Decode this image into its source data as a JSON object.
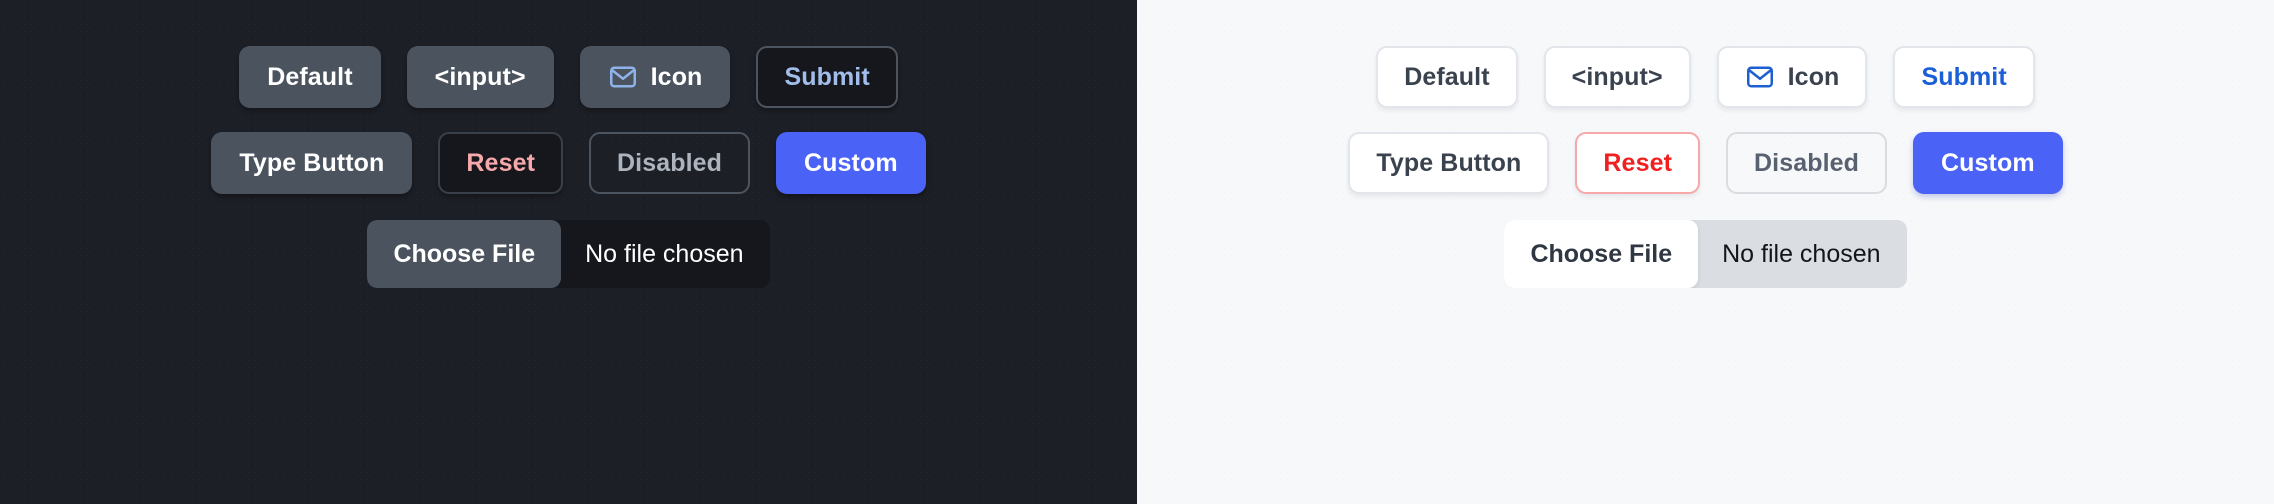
{
  "panels": [
    {
      "theme": "dark",
      "background": "#1c1f26",
      "rows": [
        {
          "buttons": [
            {
              "label": "Default",
              "variant": "solid",
              "icon": null,
              "disabled": false
            },
            {
              "label": "<input>",
              "variant": "solid",
              "icon": null,
              "disabled": false
            },
            {
              "label": "Icon",
              "variant": "solid",
              "icon": "envelope-icon",
              "disabled": false
            },
            {
              "label": "Submit",
              "variant": "submit",
              "icon": null,
              "disabled": false
            }
          ]
        },
        {
          "buttons": [
            {
              "label": "Type Button",
              "variant": "solid",
              "icon": null,
              "disabled": false
            },
            {
              "label": "Reset",
              "variant": "reset",
              "icon": null,
              "disabled": false
            },
            {
              "label": "Disabled",
              "variant": "disabled",
              "icon": null,
              "disabled": true
            },
            {
              "label": "Custom",
              "variant": "custom",
              "icon": null,
              "disabled": false
            }
          ]
        }
      ],
      "file_input": {
        "button_label": "Choose File",
        "status_text": "No file chosen"
      },
      "colors": {
        "button_fill": "#4b535e",
        "button_text": "#ffffff",
        "submit_text": "#a3bdeb",
        "reset_text": "#f7a8ab",
        "disabled_text": "#aeb4bd",
        "custom_fill": "#4a62f5",
        "icon_stroke": "#8fb3e8",
        "sunken_fill": "#15171c",
        "border": "#4c545f"
      }
    },
    {
      "theme": "light",
      "background": "#f7f8fa",
      "rows": [
        {
          "buttons": [
            {
              "label": "Default",
              "variant": "solid",
              "icon": null,
              "disabled": false
            },
            {
              "label": "<input>",
              "variant": "solid",
              "icon": null,
              "disabled": false
            },
            {
              "label": "Icon",
              "variant": "solid",
              "icon": "envelope-icon",
              "disabled": false
            },
            {
              "label": "Submit",
              "variant": "submit",
              "icon": null,
              "disabled": false
            }
          ]
        },
        {
          "buttons": [
            {
              "label": "Type Button",
              "variant": "solid",
              "icon": null,
              "disabled": false
            },
            {
              "label": "Reset",
              "variant": "reset",
              "icon": null,
              "disabled": false
            },
            {
              "label": "Disabled",
              "variant": "disabled",
              "icon": null,
              "disabled": true
            },
            {
              "label": "Custom",
              "variant": "custom",
              "icon": null,
              "disabled": false
            }
          ]
        }
      ],
      "file_input": {
        "button_label": "Choose File",
        "status_text": "No file chosen"
      },
      "colors": {
        "button_fill": "#ffffff",
        "button_text": "#3a424e",
        "submit_text": "#1b5fd8",
        "reset_text": "#f02020",
        "reset_border": "#f7a8a8",
        "disabled_text": "#586170",
        "custom_fill": "#4a62f5",
        "icon_stroke": "#1d5fd0",
        "track_fill": "#dadde1",
        "border": "#e2e5e9"
      }
    }
  ]
}
